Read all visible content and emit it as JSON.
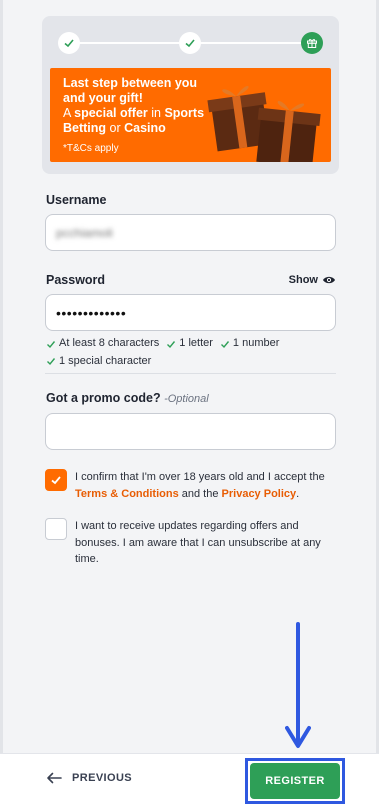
{
  "banner": {
    "line1": "Last step between you",
    "line2": "and your gift!",
    "line3_a": "A ",
    "line3_b": "special offer",
    "line3_c": " in ",
    "line3_d": "Sports",
    "line4_a": "Betting",
    "line4_b": " or ",
    "line4_c": "Casino",
    "tc": "*T&Cs apply"
  },
  "username": {
    "label": "Username",
    "value": "pcchiamoli"
  },
  "password": {
    "label": "Password",
    "show_label": "Show",
    "value": "•••••••••••••"
  },
  "rules": [
    "At least 8 characters",
    "1 letter",
    "1 number",
    "1 special character"
  ],
  "promo": {
    "label": "Got a promo code?",
    "optional": "-Optional",
    "value": ""
  },
  "consent1": {
    "text_a": "I confirm that I'm over 18 years old and I accept the ",
    "terms_link": "Terms & Conditions",
    "text_b": " and the ",
    "privacy_link": "Privacy Policy",
    "text_c": ".",
    "checked": true
  },
  "consent2": {
    "text": "I want to receive updates regarding offers and bonuses. I am aware that I can unsubscribe at any time.",
    "checked": false
  },
  "nav": {
    "previous": "PREVIOUS",
    "register": "REGISTER"
  },
  "colors": {
    "accent": "#ff6b00",
    "success": "#2e9f57",
    "highlight": "#2f58e0"
  },
  "icons": [
    "check-icon",
    "gift-icon",
    "eye-icon",
    "arrow-left-icon",
    "arrow-down-icon"
  ]
}
